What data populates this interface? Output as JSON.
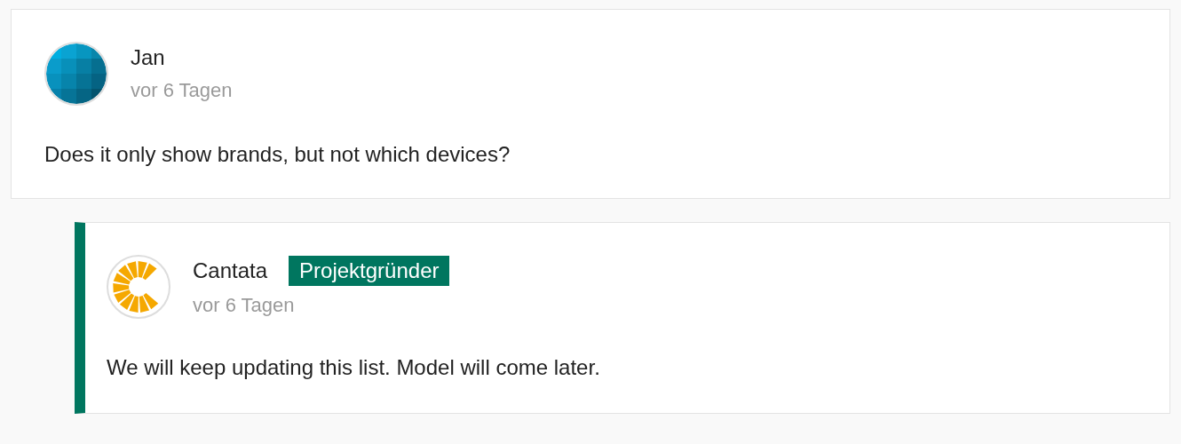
{
  "comments": [
    {
      "author": "Jan",
      "avatar": {
        "kind": "identicon"
      },
      "time": "vor 6 Tagen",
      "text": "Does it only show brands, but not which devices?",
      "children": [
        {
          "author": "Cantata",
          "avatar": {
            "kind": "logo"
          },
          "badge": "Projektgründer",
          "time": "vor 6 Tagen",
          "text": "We will keep updating this list. Model will come later."
        }
      ]
    }
  ]
}
